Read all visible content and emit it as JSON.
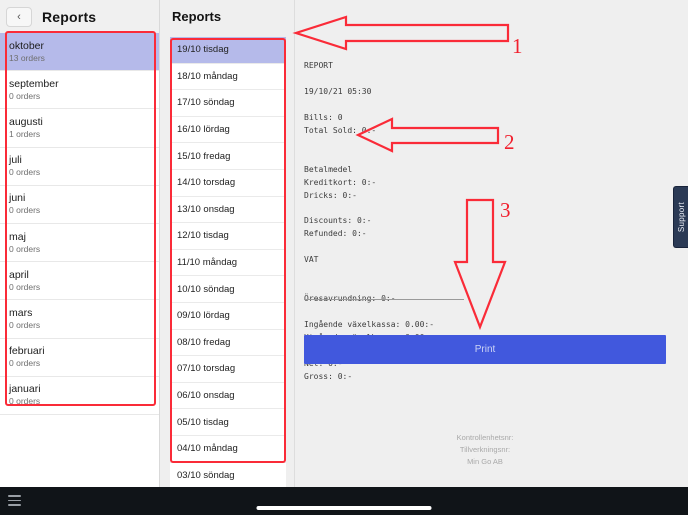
{
  "statusbar": {
    "icons": [
      "signal-icon",
      "wifi-icon",
      "bluetooth-icon",
      "sync-icon",
      "battery-icon"
    ]
  },
  "left": {
    "back_label": "‹",
    "title": "Reports",
    "months": [
      {
        "name": "oktober",
        "orders": "13 orders",
        "selected": true
      },
      {
        "name": "september",
        "orders": "0 orders",
        "selected": false
      },
      {
        "name": "augusti",
        "orders": "1 orders",
        "selected": false
      },
      {
        "name": "juli",
        "orders": "0 orders",
        "selected": false
      },
      {
        "name": "juni",
        "orders": "0 orders",
        "selected": false
      },
      {
        "name": "maj",
        "orders": "0 orders",
        "selected": false
      },
      {
        "name": "april",
        "orders": "0 orders",
        "selected": false
      },
      {
        "name": "mars",
        "orders": "0 orders",
        "selected": false
      },
      {
        "name": "februari",
        "orders": "0 orders",
        "selected": false
      },
      {
        "name": "januari",
        "orders": "0 orders",
        "selected": false
      }
    ]
  },
  "middle": {
    "title": "Reports",
    "days": [
      {
        "label": "19/10 tisdag",
        "selected": true
      },
      {
        "label": "18/10 måndag",
        "selected": false
      },
      {
        "label": "17/10 söndag",
        "selected": false
      },
      {
        "label": "16/10 lördag",
        "selected": false
      },
      {
        "label": "15/10 fredag",
        "selected": false
      },
      {
        "label": "14/10 torsdag",
        "selected": false
      },
      {
        "label": "13/10 onsdag",
        "selected": false
      },
      {
        "label": "12/10 tisdag",
        "selected": false
      },
      {
        "label": "11/10 måndag",
        "selected": false
      },
      {
        "label": "10/10 söndag",
        "selected": false
      },
      {
        "label": "09/10 lördag",
        "selected": false
      },
      {
        "label": "08/10 fredag",
        "selected": false
      },
      {
        "label": "07/10 torsdag",
        "selected": false
      },
      {
        "label": "06/10 onsdag",
        "selected": false
      },
      {
        "label": "05/10 tisdag",
        "selected": false
      },
      {
        "label": "04/10 måndag",
        "selected": false
      },
      {
        "label": "03/10 söndag",
        "selected": false
      }
    ]
  },
  "report": {
    "text": "REPORT\n\n19/10/21 05:30\n\nBills: 0\nTotal Sold: 0:-\n\n\nBetalmedel\nKreditkort: 0:-\nDricks: 0:-\n\nDiscounts: 0:-\nRefunded: 0:-\n\nVAT\n\n\nÖresavrundning: 0:-\n\nIngående växelkassa: 0.00:-\nUtgående växelkassa: 0.00:-\n\nNet: 0:-\nGross: 0:-",
    "print_label": "Print",
    "footer_line1": "Kontrollenhetsnr:",
    "footer_line2": "Tillverkningsnr:",
    "footer_line3": "Min Go AB"
  },
  "support": {
    "label": "Support"
  },
  "annotations": {
    "one": "1",
    "two": "2",
    "three": "3"
  },
  "colors": {
    "accent_blue": "#4158dd",
    "selection": "#b5baea",
    "annotation_red": "#fa2b38",
    "support_navy": "#2b3a55"
  }
}
